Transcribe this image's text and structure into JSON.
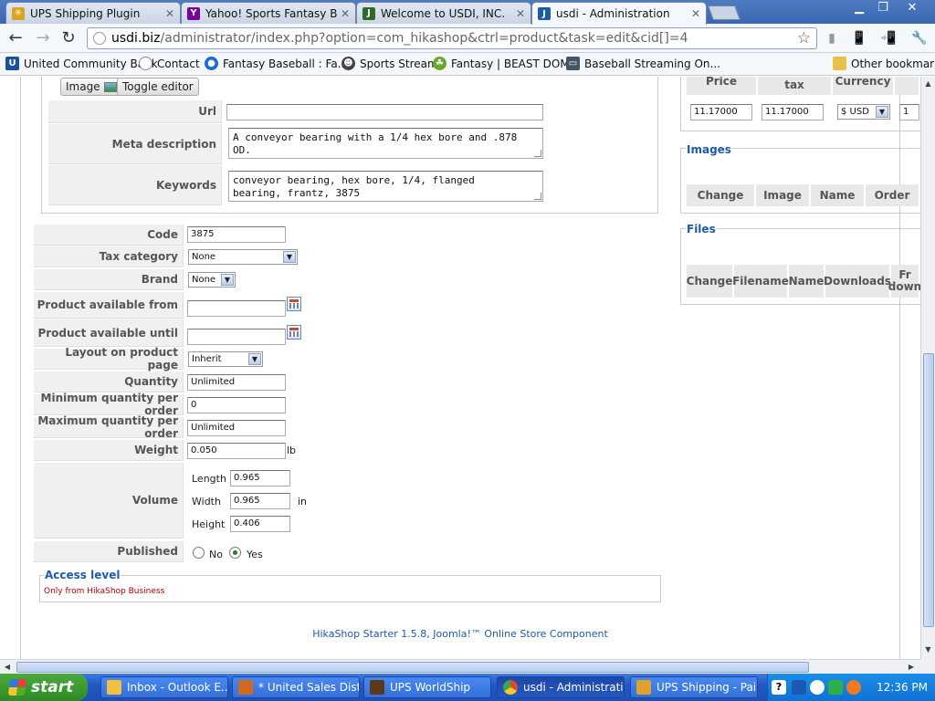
{
  "browser": {
    "tabs": [
      {
        "label": "UPS Shipping Plugin",
        "color": "#d9a31c"
      },
      {
        "label": "Yahoo! Sports Fantasy Baseb",
        "color": "#7b0099"
      },
      {
        "label": "Welcome to USDI, INC.",
        "color": "#2b6a2b"
      },
      {
        "label": "usdi - Administration",
        "color": "#1d5aa8"
      }
    ],
    "url_host": "usdi.biz",
    "url_path": "/administrator/index.php?option=com_hikashop&ctrl=product&task=edit&cid[]=4",
    "bookmarks": [
      {
        "label": "United Community Bank",
        "color": "#1c4fa0"
      },
      {
        "label": "Contact",
        "color": "#888888"
      },
      {
        "label": "Fantasy Baseball : Fa...",
        "color": "#1b6ad6"
      },
      {
        "label": "Sports Stream",
        "color": "#444444"
      },
      {
        "label": "Fantasy | BEAST DOME",
        "color": "#6aa82a"
      },
      {
        "label": "Baseball Streaming On...",
        "color": "#445566"
      }
    ],
    "other_bookmarks": "Other bookmarks"
  },
  "editor": {
    "image_button": "Image",
    "toggle_button": "Toggle editor"
  },
  "meta": {
    "url_label": "Url",
    "url_value": "",
    "meta_description_label": "Meta description",
    "meta_description_value": "A conveyor bearing with a 1/4 hex bore and .878\nOD.",
    "keywords_label": "Keywords",
    "keywords_value": "conveyor bearing, hex bore, 1/4, flanged\nbearing, frantz, 3875"
  },
  "product": {
    "code_label": "Code",
    "code_value": "3875",
    "tax_label": "Tax category",
    "tax_value": "None",
    "brand_label": "Brand",
    "brand_value": "None",
    "avail_from_label": "Product available from",
    "avail_from_value": "",
    "avail_until_label": "Product available until",
    "avail_until_value": "",
    "layout_label": "Layout on product page",
    "layout_value": "Inherit",
    "quantity_label": "Quantity",
    "quantity_value": "Unlimited",
    "min_qty_label": "Minimum quantity per order",
    "min_qty_value": "0",
    "max_qty_label": "Maximum quantity per order",
    "max_qty_value": "Unlimited",
    "weight_label": "Weight",
    "weight_value": "0.050",
    "weight_unit": "lb",
    "volume_label": "Volume",
    "length_label": "Length",
    "length_value": "0.965",
    "width_label": "Width",
    "width_value": "0.965",
    "height_label": "Height",
    "height_value": "0.406",
    "volume_unit": "in",
    "published_label": "Published",
    "published_no": "No",
    "published_yes": "Yes",
    "published_selected": "Yes"
  },
  "access": {
    "legend": "Access level",
    "text": "Only from HikaShop Business"
  },
  "prices": {
    "header_price": "Price",
    "header_tax": "tax",
    "header_currency": "Currency",
    "price_value": "11.17000",
    "price_tax_value": "11.17000",
    "currency_value": "$ USD",
    "qty_value": "1"
  },
  "images": {
    "legend": "Images",
    "headers": [
      "Change",
      "Image",
      "Name",
      "Order"
    ]
  },
  "files": {
    "legend": "Files",
    "headers": [
      "Change",
      "Filename",
      "Name",
      "Downloads",
      "Fr\ndown"
    ]
  },
  "footer": "HikaShop Starter 1.5.8, Joomla!™ Online Store Component",
  "taskbar": {
    "start": "start",
    "tasks": [
      {
        "label": "Inbox - Outlook E...",
        "color": "#f0c040"
      },
      {
        "label": "* United Sales Dist...",
        "color": "#d06a20"
      },
      {
        "label": "UPS WorldShip",
        "color": "#5a3a1a"
      },
      {
        "label": "usdi - Administrati...",
        "color": "#e04a2a"
      },
      {
        "label": "UPS Shipping - Paint",
        "color": "#e0a030"
      }
    ],
    "clock": "12:36 PM"
  }
}
